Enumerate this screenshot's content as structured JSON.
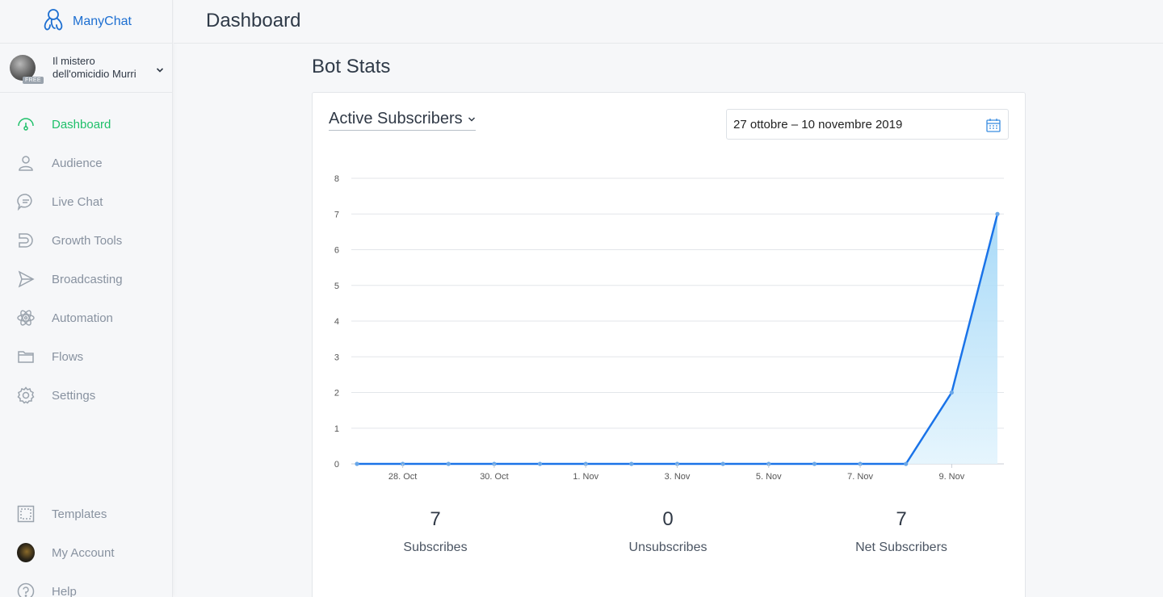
{
  "brand": {
    "name": "ManyChat"
  },
  "account": {
    "line1": "Il mistero",
    "line2": "dell'omicidio Murri",
    "badge": "FREE"
  },
  "nav": [
    {
      "key": "dashboard",
      "label": "Dashboard",
      "icon": "speedometer-icon",
      "active": true
    },
    {
      "key": "audience",
      "label": "Audience",
      "icon": "user-icon"
    },
    {
      "key": "livechat",
      "label": "Live Chat",
      "icon": "chat-bubble-icon"
    },
    {
      "key": "growth",
      "label": "Growth Tools",
      "icon": "magnet-icon"
    },
    {
      "key": "broadcasting",
      "label": "Broadcasting",
      "icon": "send-icon"
    },
    {
      "key": "automation",
      "label": "Automation",
      "icon": "atom-icon"
    },
    {
      "key": "flows",
      "label": "Flows",
      "icon": "folder-icon"
    },
    {
      "key": "settings",
      "label": "Settings",
      "icon": "gear-icon"
    }
  ],
  "nav_bottom": [
    {
      "key": "templates",
      "label": "Templates",
      "icon": "templates-icon"
    },
    {
      "key": "myaccount",
      "label": "My Account",
      "icon": "avatar"
    },
    {
      "key": "help",
      "label": "Help",
      "icon": "help-icon"
    }
  ],
  "header": {
    "title": "Dashboard"
  },
  "main": {
    "section_title": "Bot Stats",
    "metric_select": "Active Subscribers",
    "date_range": "27 ottobre – 10 novembre 2019"
  },
  "colors": {
    "accent_green": "#1fc06a",
    "line_blue": "#1a73e8",
    "brand_blue": "#1d6fd1"
  },
  "chart_data": {
    "type": "area",
    "x": [
      "27 Oct",
      "28 Oct",
      "29 Oct",
      "30 Oct",
      "31 Oct",
      "1 Nov",
      "2 Nov",
      "3 Nov",
      "4 Nov",
      "5 Nov",
      "6 Nov",
      "7 Nov",
      "8 Nov",
      "9 Nov",
      "10 Nov"
    ],
    "x_tick_labels": [
      "28. Oct",
      "30. Oct",
      "1. Nov",
      "3. Nov",
      "5. Nov",
      "7. Nov",
      "9. Nov"
    ],
    "x_tick_indices": [
      1,
      3,
      5,
      7,
      9,
      11,
      13
    ],
    "series": [
      {
        "values": [
          0,
          0,
          0,
          0,
          0,
          0,
          0,
          0,
          0,
          0,
          0,
          0,
          0,
          2,
          7
        ]
      }
    ],
    "ylim": [
      0,
      8
    ],
    "y_ticks": [
      0,
      1,
      2,
      3,
      4,
      5,
      6,
      7,
      8
    ],
    "grid": true,
    "legend": "none"
  },
  "stats": [
    {
      "value": "7",
      "label": "Subscribes"
    },
    {
      "value": "0",
      "label": "Unsubscribes"
    },
    {
      "value": "7",
      "label": "Net Subscribers"
    }
  ]
}
